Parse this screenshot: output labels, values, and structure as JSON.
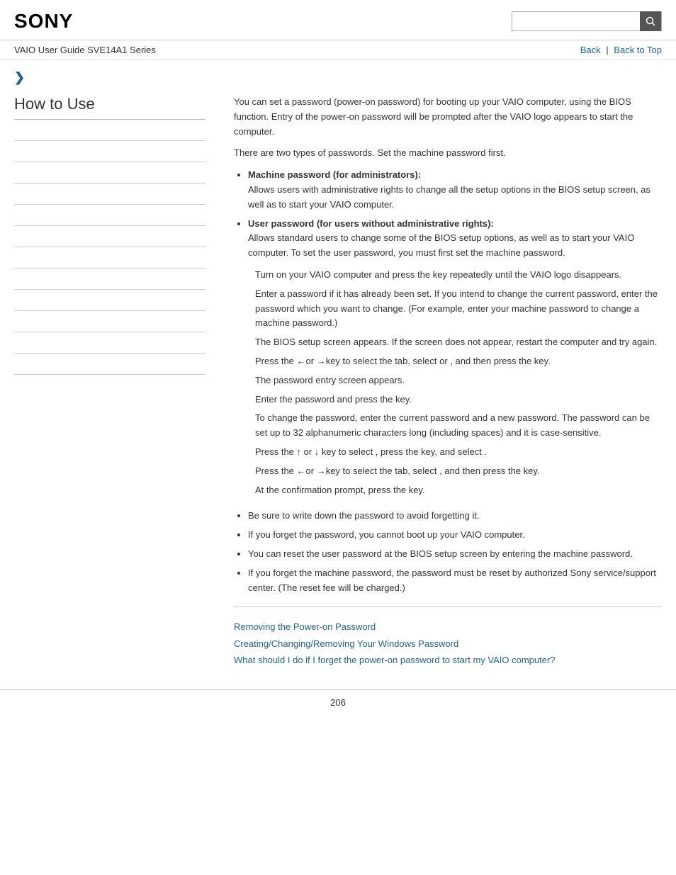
{
  "header": {
    "logo": "SONY",
    "search_placeholder": ""
  },
  "nav": {
    "guide_title": "VAIO User Guide SVE14A1 Series",
    "back_label": "Back",
    "back_to_top_label": "Back to Top"
  },
  "sidebar": {
    "title": "How to Use",
    "items": [
      {
        "label": ""
      },
      {
        "label": ""
      },
      {
        "label": ""
      },
      {
        "label": ""
      },
      {
        "label": ""
      },
      {
        "label": ""
      },
      {
        "label": ""
      },
      {
        "label": ""
      },
      {
        "label": ""
      },
      {
        "label": ""
      },
      {
        "label": ""
      },
      {
        "label": ""
      }
    ]
  },
  "content": {
    "intro_p1": "You can set a password (power-on password) for booting up your VAIO computer, using the BIOS function. Entry of the power-on password will be prompted after the VAIO logo appears to start the computer.",
    "intro_p2": "There are two types of passwords. Set the machine password first.",
    "bullet1_title": "Machine password (for administrators):",
    "bullet1_body": "Allows users with administrative rights to change all the setup options in the BIOS setup screen, as well as to start your VAIO computer.",
    "bullet2_title": "User password (for users without administrative rights):",
    "bullet2_body": "Allows standard users to change some of the BIOS setup options, as well as to start your VAIO computer. To set the user password, you must first set the machine password.",
    "step1": "Turn on your VAIO computer and press the       key repeatedly until the VAIO logo disappears.",
    "step2": "Enter a password if it has already been set. If you intend to change the current password, enter the password which you want to change. (For example, enter your machine password to change a machine password.)",
    "step3": "The BIOS setup screen appears. If the screen does not appear, restart the computer and try again.",
    "step4": "Press the ←or →key to select the               tab, select or                        , and then press the        key.",
    "step4b": "The password entry screen appears.",
    "step5": "Enter the password and press the         key.",
    "step5b": "To change the password, enter the current password and a new password. The password can be set up to 32 alphanumeric characters long (including spaces) and it is case-sensitive.",
    "step6": "Press the ↑ or ↓ key to select                        , press the        key, and select        .",
    "step7": "Press the ←or →key to select the        tab, select           , and then press the        key.",
    "step8": "At the confirmation prompt, press the         key.",
    "note1": "Be sure to write down the password to avoid forgetting it.",
    "note2": "If you forget the password, you cannot boot up your VAIO computer.",
    "note3": "You can reset the user password at the BIOS setup screen by entering the machine password.",
    "note4": "If you forget the machine password, the password must be reset by authorized Sony service/support center. (The reset fee will be charged.)",
    "related_links": [
      {
        "label": "Removing the Power-on Password",
        "href": "#"
      },
      {
        "label": "Creating/Changing/Removing Your Windows Password",
        "href": "#"
      },
      {
        "label": "What should I do if I forget the power-on password to start my VAIO computer?",
        "href": "#"
      }
    ],
    "page_number": "206"
  }
}
